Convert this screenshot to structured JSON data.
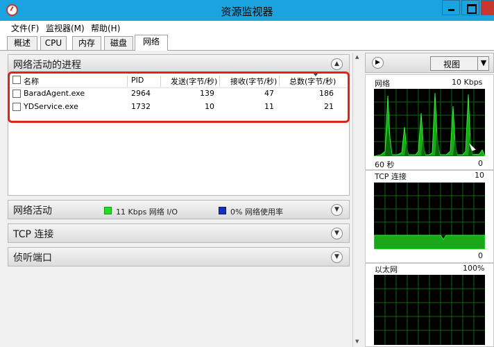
{
  "window": {
    "title": "资源监视器"
  },
  "menu": [
    "文件(F)",
    "监视器(M)",
    "帮助(H)"
  ],
  "tabs": [
    "概述",
    "CPU",
    "内存",
    "磁盘",
    "网络"
  ],
  "sections": {
    "processes": {
      "title": "网络活动的进程",
      "columns": [
        "名称",
        "PID",
        "发送(字节/秒)",
        "接收(字节/秒)",
        "总数(字节/秒)"
      ],
      "rows": [
        {
          "name": "BaradAgent.exe",
          "pid": "2964",
          "send": "139",
          "recv": "47",
          "total": "186"
        },
        {
          "name": "YDService.exe",
          "pid": "1732",
          "send": "10",
          "recv": "11",
          "total": "21"
        }
      ]
    },
    "network_activity": {
      "title": "网络活动",
      "io_text": "11 Kbps 网络 I/O",
      "io_color": "#22dd22",
      "usage_text": "0% 网络使用率",
      "usage_color": "#1a2fb8"
    },
    "tcp": {
      "title": "TCP 连接"
    },
    "listen": {
      "title": "侦听端口"
    }
  },
  "right_panel": {
    "view_label": "视图",
    "graphs": [
      {
        "title": "网络",
        "max": "10 Kbps",
        "footer_left": "60 秒",
        "footer_right": "0"
      },
      {
        "title": "TCP 连接",
        "max": "10",
        "footer_right": "0"
      },
      {
        "title": "以太网",
        "max": "100%"
      }
    ]
  },
  "colors": {
    "titlebar": "#1aa3df",
    "highlight": "#e0231a",
    "graph_line": "#1edc1e"
  }
}
